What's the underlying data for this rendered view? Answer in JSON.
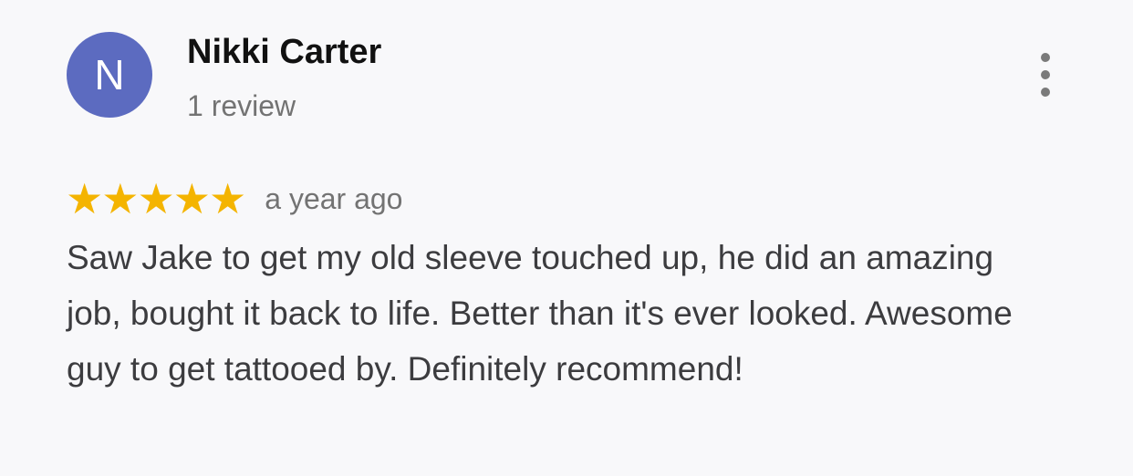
{
  "reviewer": {
    "initial": "N",
    "name": "Nikki Carter",
    "review_count": "1 review",
    "avatar_color": "#5c6bc0"
  },
  "menu": {
    "icon": "more-vert-icon"
  },
  "rating": {
    "stars": 5,
    "max_stars": 5,
    "star_color": "#f4b400",
    "time_ago": "a year ago"
  },
  "review": {
    "text": "Saw Jake to get my old sleeve touched up, he did an amazing job, bought it back to life. Better than it's ever looked. Awesome guy to get tattooed by. Definitely recommend!"
  }
}
